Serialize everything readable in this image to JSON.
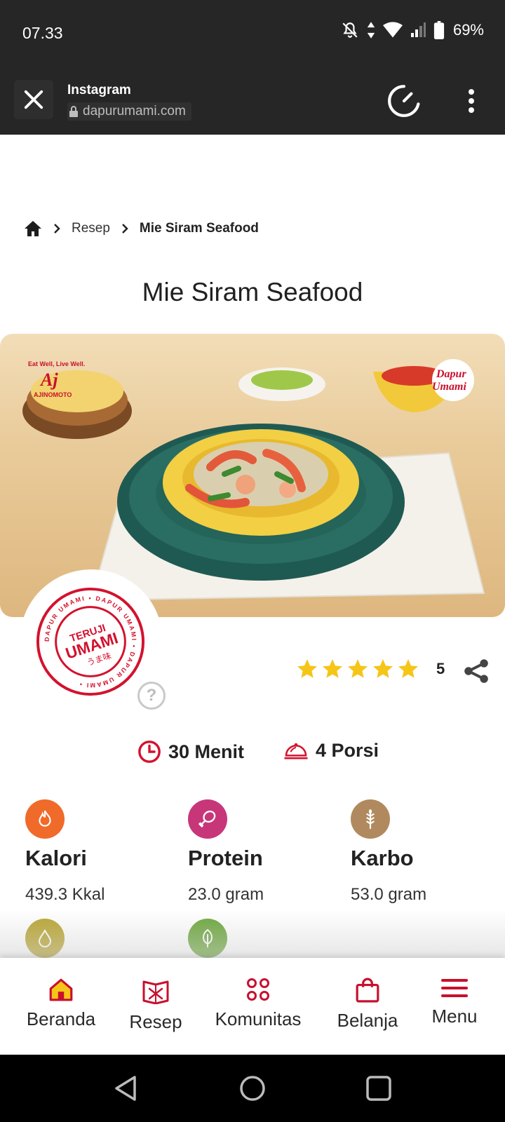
{
  "status_bar": {
    "time": "07.33",
    "battery": "69%"
  },
  "browser": {
    "title": "Instagram",
    "url": "dapurumami.com"
  },
  "breadcrumb": {
    "items": [
      "Resep",
      "Mie Siram Seafood"
    ]
  },
  "recipe": {
    "title": "Mie Siram Seafood",
    "rating": "5",
    "rating_stars": 5,
    "time": "30 Menit",
    "portions": "4 Porsi"
  },
  "hero": {
    "logo_tagline": "Eat Well, Live Well.",
    "logo_mark": "Aj",
    "logo_brand": "AJINOMOTO",
    "logo_dapur": "Dapur",
    "logo_umami": "Umami"
  },
  "badge": {
    "top_text": "TERUJI",
    "main_text": "UMAMI",
    "kana_text": "うま味",
    "ring_text": "DAPUR UMAMI • DAPUR UMAMI • DAPUR UMAMI •"
  },
  "nutrition": [
    {
      "name": "Kalori",
      "value": "439.3 Kkal",
      "color": "#f06a2a",
      "icon": "flame-icon"
    },
    {
      "name": "Protein",
      "value": "23.0 gram",
      "color": "#c8367a",
      "icon": "drumstick-icon"
    },
    {
      "name": "Karbo",
      "value": "53.0 gram",
      "color": "#b08a5e",
      "icon": "wheat-icon"
    }
  ],
  "nutrition_more": [
    {
      "color": "#b8a42e",
      "icon": "drop-icon"
    },
    {
      "color": "#6aa63a",
      "icon": "leaf-icon"
    }
  ],
  "bottom_nav": [
    {
      "label": "Beranda",
      "icon": "home-icon"
    },
    {
      "label": "Resep",
      "icon": "recipe-book-icon"
    },
    {
      "label": "Komunitas",
      "icon": "community-icon"
    },
    {
      "label": "Belanja",
      "icon": "shopping-bag-icon"
    },
    {
      "label": "Menu",
      "icon": "hamburger-menu-icon"
    }
  ],
  "colors": {
    "brand_red": "#d3122e",
    "star": "#f5c518",
    "dark_bar": "#262626"
  }
}
